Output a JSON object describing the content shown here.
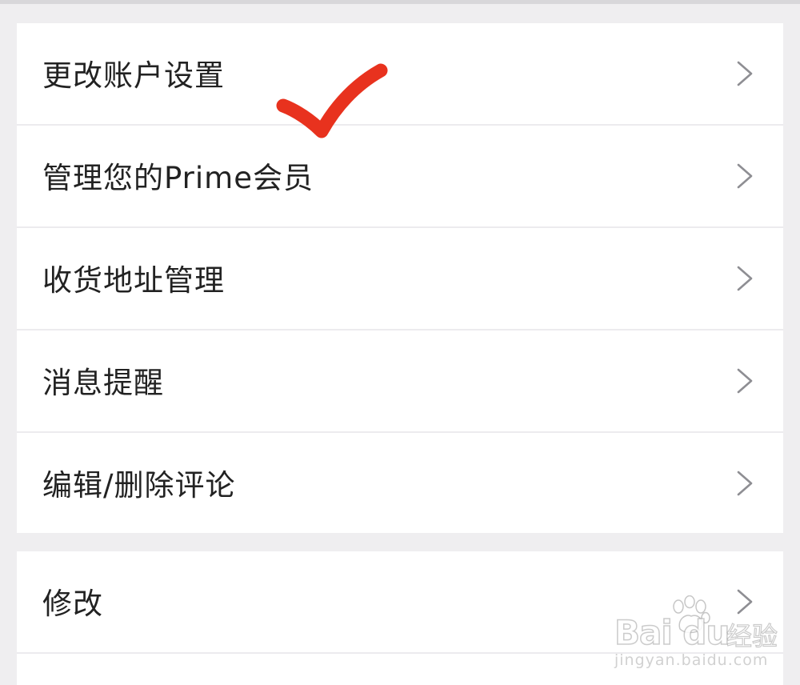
{
  "menu_group_1": {
    "items": [
      {
        "label": "更改账户设置"
      },
      {
        "label": "管理您的Prime会员"
      },
      {
        "label": "收货地址管理"
      },
      {
        "label": "消息提醒"
      },
      {
        "label": "编辑/删除评论"
      }
    ]
  },
  "menu_group_2": {
    "items": [
      {
        "label": "修改"
      }
    ]
  },
  "annotation": {
    "icon": "red-checkmark-annotation",
    "color": "#e8321e"
  },
  "watermark": {
    "brand": "Bai du",
    "cn": "经验",
    "url": "jingyan.baidu.com"
  },
  "colors": {
    "background": "#efeef0",
    "card": "#ffffff",
    "text": "#222222",
    "chevron": "#8e8e93"
  }
}
